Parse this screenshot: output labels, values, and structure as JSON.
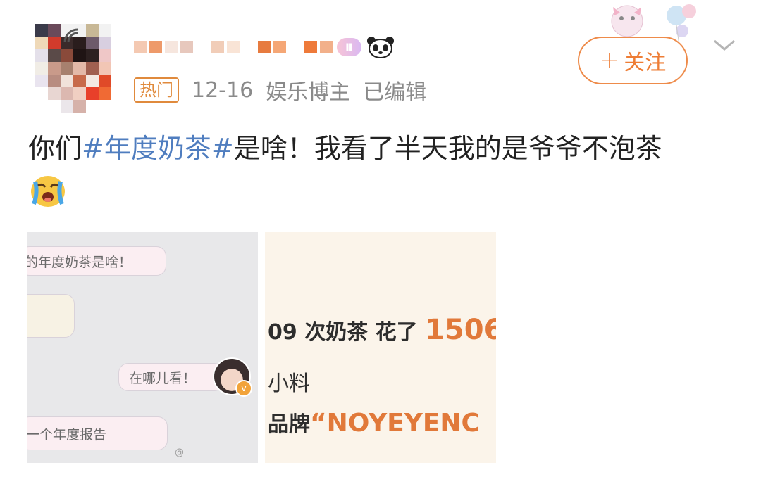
{
  "post": {
    "level_badge": "Ⅱ",
    "meta": {
      "hot_tag": "热门",
      "date": "12-16",
      "user_type": "娱乐博主",
      "edited": "已编辑"
    },
    "follow_label": "关注",
    "follow_plus": "+",
    "text": {
      "prefix": "你们",
      "topic": "#年度奶茶#",
      "suffix": "是啥！我看了半天我的是爷爷不泡茶"
    }
  },
  "image_left": {
    "bubble_1": "的年度奶茶是啥！",
    "bubble_2_small": "",
    "bubble_3": "在哪儿看！",
    "bubble_4": "一个年度报告",
    "watermark": "@"
  },
  "image_right": {
    "line_1_text": "09 次奶茶 花了",
    "line_1_value": "1506",
    "line_2_text": "小料",
    "line_3_prefix": "品牌",
    "line_3_brand": "“NOYEYENC"
  },
  "colors": {
    "accent_orange": "#ee7d35",
    "topic_blue": "#4f7dbf",
    "meta_gray": "#8a8a8a"
  }
}
